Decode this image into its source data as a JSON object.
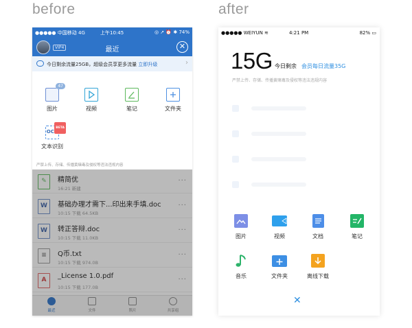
{
  "labels": {
    "before": "before",
    "after": "after"
  },
  "before": {
    "status": {
      "carrier": "●●●●● 中国移动  4G",
      "time": "上午10:45",
      "battery": "◎ ➚ ⏰ ✱ 74%"
    },
    "header": {
      "vip": "VIP4",
      "title": "最近",
      "close": "✕"
    },
    "promo": {
      "text": "今日剩余流量25GB，超级会员享更多流量",
      "link": "立即升级",
      "chevron": "›"
    },
    "grid": [
      {
        "label": "图片",
        "badge": "47"
      },
      {
        "label": "视频"
      },
      {
        "label": "笔记"
      },
      {
        "label": "文件夹"
      },
      {
        "label": "文本识别",
        "badge": "BETA",
        "icon_text": "OCR"
      }
    ],
    "notice": "严禁上传、存储、传播黄赌毒及侵权等违法违规内容",
    "files": [
      {
        "name": "精简优",
        "meta": "16:21 新建",
        "icon": "✎"
      },
      {
        "name": "基础办理才需下...印出来手填.doc",
        "meta": "10:15 下载 64.5KB",
        "icon": "W"
      },
      {
        "name": "转正答辩.doc",
        "meta": "10:15 下载 11.0KB",
        "icon": "W"
      },
      {
        "name": "Q币.txt",
        "meta": "10:15 下载 974.0B",
        "icon": "≡"
      },
      {
        "name": "_License 1.0.pdf",
        "meta": "10:15 下载 177.0B",
        "icon": "A"
      }
    ],
    "more": "···",
    "tabs": [
      "最近",
      "文件",
      "照片",
      "共享组"
    ]
  },
  "after": {
    "status": {
      "carrier": "●●●●● WEIYUN ≋",
      "time": "4:21 PM",
      "battery": "82% ▭"
    },
    "big": "15G",
    "sub1": "今日剩余",
    "sub2": "会员每日流量35G",
    "notice": "严禁上传、存储、传播黄赌毒及侵权等违法违规内容",
    "items": [
      "图片",
      "视频",
      "文档",
      "笔记",
      "音乐",
      "文件夹",
      "离线下载"
    ],
    "close": "✕"
  },
  "colors": {
    "before_blue": "#2e74c9",
    "after_blue": "#2c8ee0",
    "after_picture": "#7d8fe6",
    "after_video": "#2ea0ec",
    "after_doc": "#4d8ee8",
    "after_note": "#23b567",
    "after_music": "#2db36b",
    "after_folder": "#3d8fe4",
    "after_offline": "#f4a31f"
  }
}
